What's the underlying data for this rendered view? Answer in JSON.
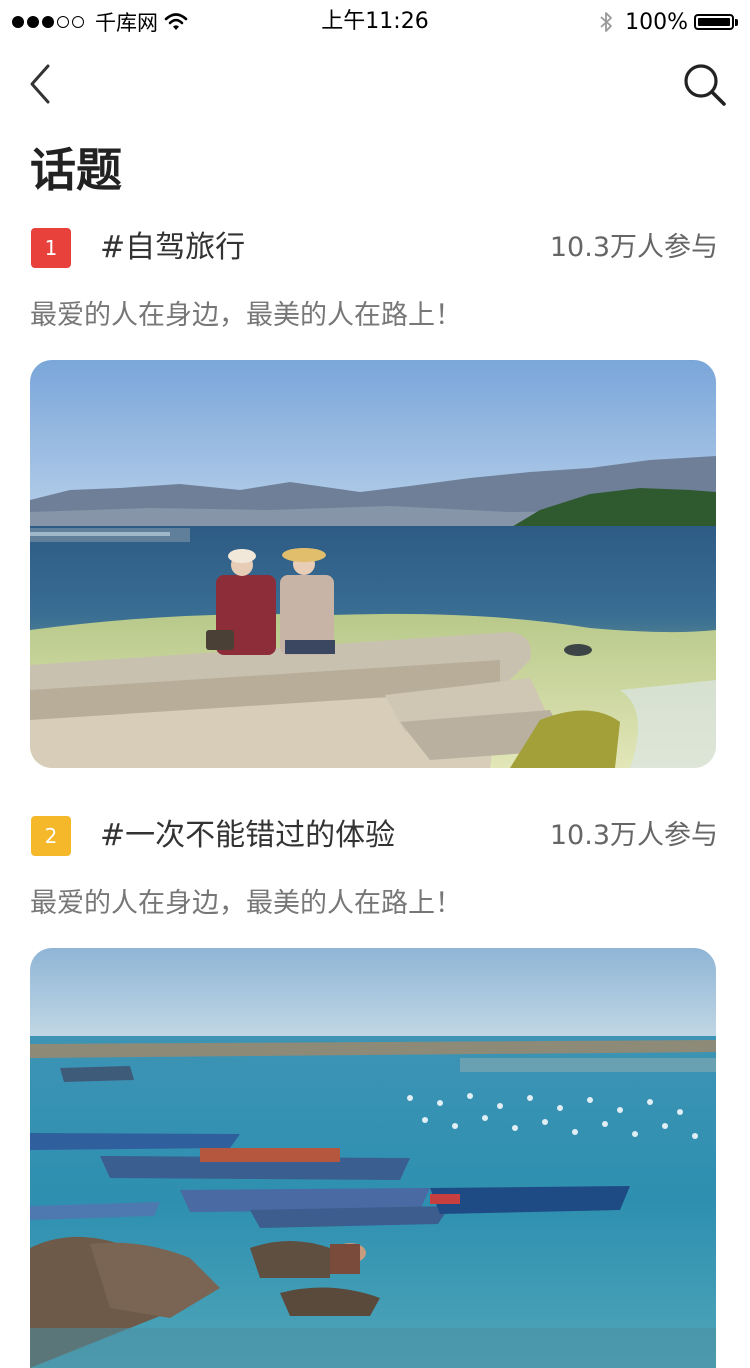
{
  "status_bar": {
    "carrier": "千库网",
    "time": "上午11:26",
    "battery": "100%",
    "battery_level": 1.0
  },
  "nav": {
    "back_icon": "chevron-left-icon",
    "search_icon": "search-icon"
  },
  "page": {
    "title": "话题"
  },
  "topics": [
    {
      "rank": "1",
      "rank_color": "#e8403a",
      "name": "#自驾旅行",
      "participants": "10.3万人参与",
      "slogan": "最爱的人在身边，最美的人在路上！"
    },
    {
      "rank": "2",
      "rank_color": "#f5b82a",
      "name": "#一次不能错过的体验",
      "participants": "10.3万人参与",
      "slogan": "最爱的人在身边，最美的人在路上！"
    }
  ]
}
